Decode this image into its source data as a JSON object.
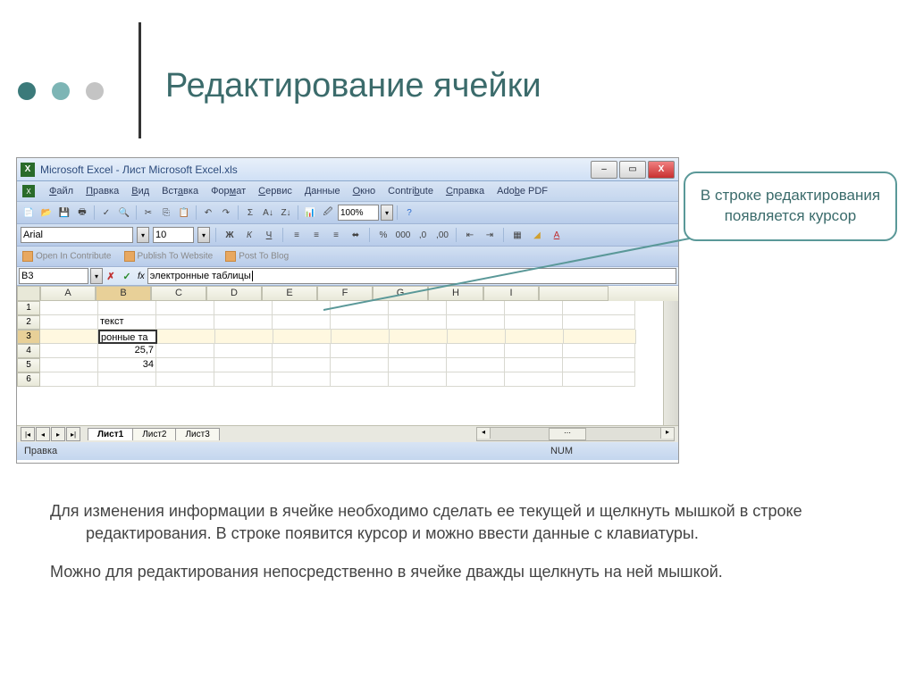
{
  "slide": {
    "title": "Редактирование ячейки",
    "callout": "В строке редактирования появляется курсор",
    "paragraph1": "Для изменения информации в ячейке необходимо сделать ее текущей и щелкнуть мышкой в строке редактирования.  В строке появится курсор и можно ввести данные с клавиатуры.",
    "paragraph2": "Можно для редактирования непосредственно в ячейке дважды щелкнуть на ней мышкой."
  },
  "excel": {
    "window_title": "Microsoft Excel - Лист Microsoft Excel.xls",
    "menu": [
      "Файл",
      "Правка",
      "Вид",
      "Вставка",
      "Формат",
      "Сервис",
      "Данные",
      "Окно",
      "Contribute",
      "Справка",
      "Adobe PDF"
    ],
    "zoom": "100%",
    "font": "Arial",
    "font_size": "10",
    "contribute": [
      "Open In Contribute",
      "Publish To Website",
      "Post To Blog"
    ],
    "name_box": "B3",
    "formula": "электронные таблицы",
    "columns": [
      "A",
      "B",
      "C",
      "D",
      "E",
      "F",
      "G",
      "H",
      "I"
    ],
    "rows": [
      "1",
      "2",
      "3",
      "4",
      "5",
      "6"
    ],
    "cells": {
      "B2": "текст",
      "B3": "ронные та",
      "B4": "25,7",
      "B5": "34"
    },
    "sheets": [
      "Лист1",
      "Лист2",
      "Лист3"
    ],
    "status_left": "Правка",
    "status_right": "NUM"
  }
}
